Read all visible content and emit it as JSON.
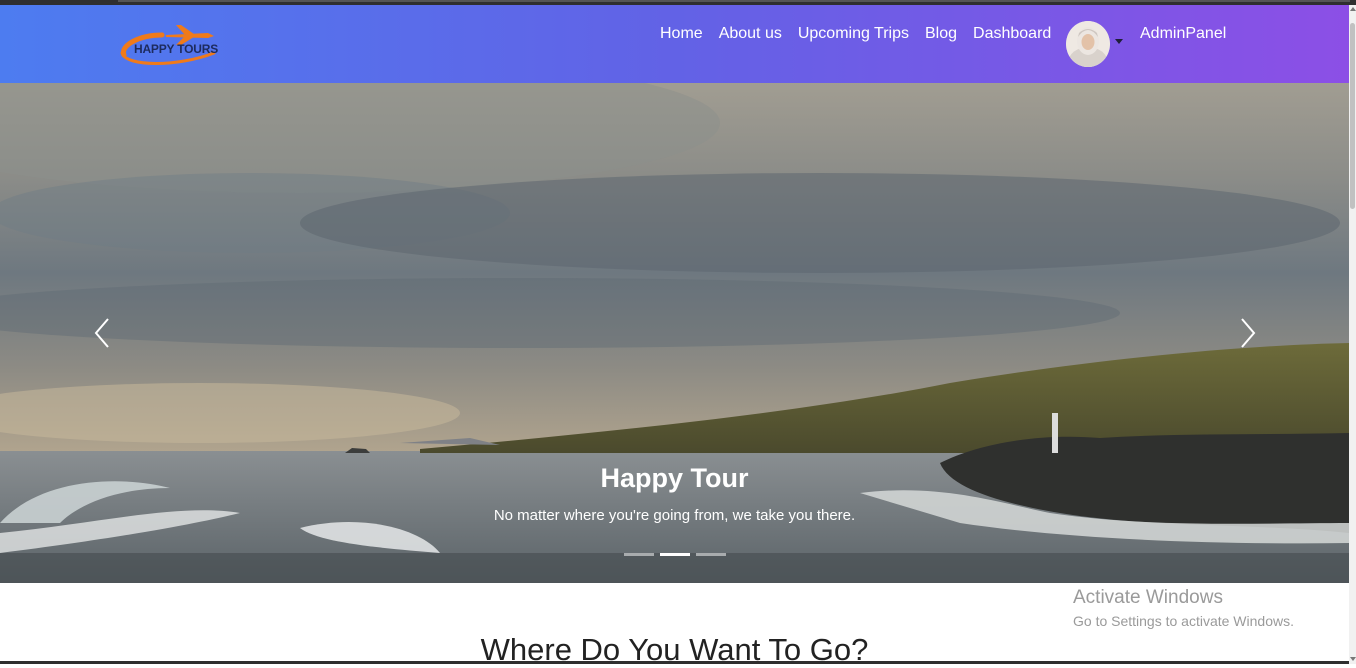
{
  "brand": {
    "logo_text": "HAPPY TOURS",
    "primary_gradient": [
      "#4d7cf0",
      "#8c4fe6"
    ]
  },
  "nav": {
    "links": [
      {
        "label": "Home"
      },
      {
        "label": "About us"
      },
      {
        "label": "Upcoming Trips"
      },
      {
        "label": "Blog"
      },
      {
        "label": "Dashboard"
      }
    ],
    "admin_label": "AdminPanel"
  },
  "hero": {
    "title": "Happy Tour",
    "subtitle": "No matter where you're going from, we take you there.",
    "slide_count": 3,
    "active_slide": 2
  },
  "main": {
    "section_title": "Where Do You Want To Go?"
  },
  "watermark": {
    "title": "Activate Windows",
    "subtitle": "Go to Settings to activate Windows."
  }
}
